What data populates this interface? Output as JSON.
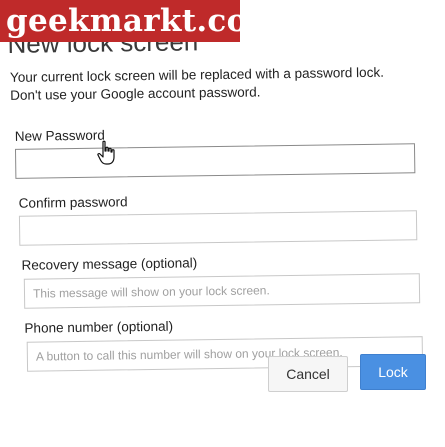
{
  "watermark": {
    "text": "geekmarkt.com"
  },
  "dialog": {
    "title": "New lock screen",
    "description_lines": [
      "Your current lock screen will be replaced with a password lock.",
      "Don't use your Google account password."
    ]
  },
  "fields": {
    "new_password": {
      "label": "New Password",
      "value": "",
      "placeholder": ""
    },
    "confirm_password": {
      "label": "Confirm password",
      "value": "",
      "placeholder": ""
    },
    "recovery_message": {
      "label": "Recovery message (optional)",
      "value": "",
      "placeholder": "This message will show on your lock screen."
    },
    "phone_number": {
      "label": "Phone number (optional)",
      "value": "",
      "placeholder": "A button to call this number will show on your lock screen."
    }
  },
  "buttons": {
    "cancel_label": "Cancel",
    "lock_label": "Lock",
    "lock_color": "#4a90e2"
  },
  "cursor": {
    "icon": "hand-pointer-icon"
  }
}
